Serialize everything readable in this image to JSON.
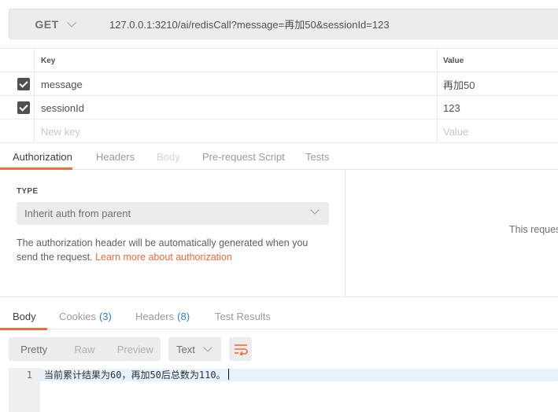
{
  "request": {
    "method": "GET",
    "url": "127.0.0.1:3210/ai/redisCall?message=再加50&sessionId=123"
  },
  "params": {
    "header_key": "Key",
    "header_value": "Value",
    "rows": [
      {
        "key": "message",
        "value": "再加50",
        "checked": true
      },
      {
        "key": "sessionId",
        "value": "123",
        "checked": true
      }
    ],
    "new_key_placeholder": "New key",
    "new_value_placeholder": "Value"
  },
  "request_tabs": [
    "Authorization",
    "Headers",
    "Body",
    "Pre-request Script",
    "Tests"
  ],
  "auth": {
    "type_label": "TYPE",
    "type_value": "Inherit auth from parent",
    "description": "The authorization header will be automatically generated when you send the request. ",
    "link_text": "Learn more about authorization",
    "right_message": "This reques"
  },
  "response_tabs": {
    "body": "Body",
    "cookies": "Cookies",
    "cookies_count": "(3)",
    "headers": "Headers",
    "headers_count": "(8)",
    "test_results": "Test Results"
  },
  "toolbar": {
    "views": [
      "Pretty",
      "Raw",
      "Preview"
    ],
    "format": "Text"
  },
  "response_body": {
    "line_number": "1",
    "text": "当前累计结果为60，再加50后总数为110。"
  },
  "colors": {
    "accent": "#f26b3a",
    "link_blue": "#2a7fd4"
  }
}
